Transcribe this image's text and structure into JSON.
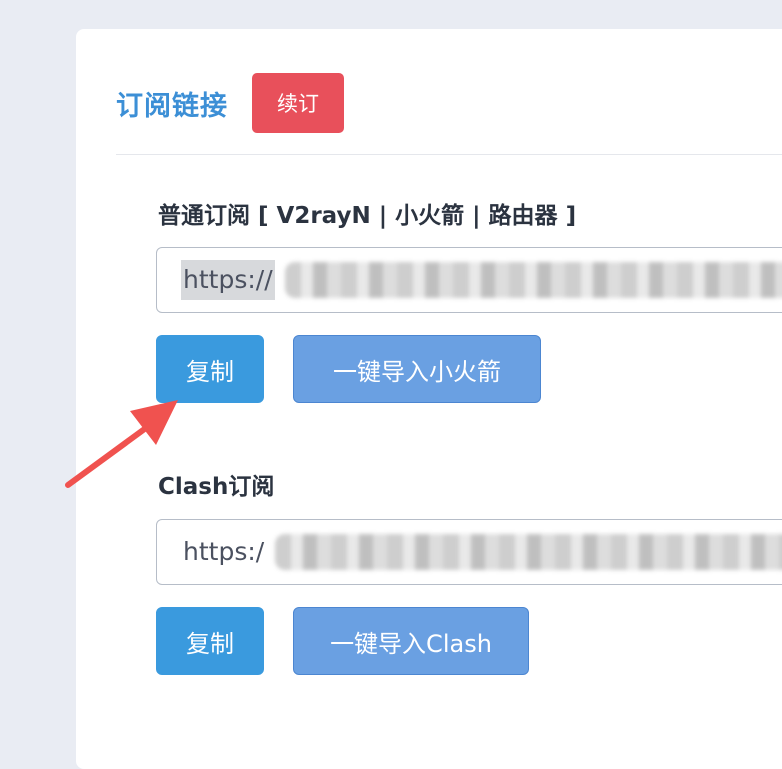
{
  "header": {
    "title": "订阅链接",
    "renew_label": "续订"
  },
  "normal_sub": {
    "label": "普通订阅 [ V2rayN | 小火箭 | 路由器 ]",
    "url_visible": "https://",
    "copy_label": "复制",
    "import_label": "一键导入小火箭"
  },
  "clash_sub": {
    "label": "Clash订阅",
    "url_visible": "https:/",
    "copy_label": "复制",
    "import_label": "一键导入Clash"
  },
  "colors": {
    "accent": "#3c8fd6",
    "danger": "#e8505b",
    "primary_button": "#3a9ade",
    "secondary_button": "#6aa0e2",
    "annotation_arrow": "#f0524f"
  }
}
